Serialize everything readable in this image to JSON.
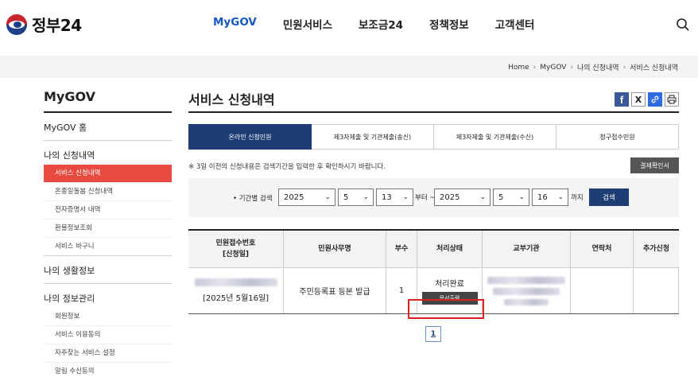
{
  "header": {
    "logo_text": "정부24",
    "nav": [
      {
        "label": "MyGOV",
        "active": true
      },
      {
        "label": "민원서비스",
        "active": false
      },
      {
        "label": "보조금24",
        "active": false
      },
      {
        "label": "정책정보",
        "active": false
      },
      {
        "label": "고객센터",
        "active": false
      }
    ],
    "search_icon": "search-icon"
  },
  "breadcrumb": [
    "Home",
    "MyGOV",
    "나의 신청내역",
    "서비스 신청내역"
  ],
  "sidebar": {
    "title": "MyGOV",
    "sections": [
      {
        "label": "MyGOV 홈",
        "items": []
      },
      {
        "label": "나의 신청내역",
        "items": [
          {
            "label": "서비스 신청내역",
            "active": true
          },
          {
            "label": "온종일돌봄 신청내역",
            "active": false
          },
          {
            "label": "전자증명서 내역",
            "active": false
          },
          {
            "label": "환불정보조회",
            "active": false
          },
          {
            "label": "서비스 바구니",
            "active": false
          }
        ]
      },
      {
        "label": "나의 생활정보",
        "items": []
      },
      {
        "label": "나의 정보관리",
        "items": [
          {
            "label": "회원정보",
            "active": false
          },
          {
            "label": "서비스 이용동의",
            "active": false
          },
          {
            "label": "자주찾는 서비스 설정",
            "active": false
          },
          {
            "label": "알림 수신동의",
            "active": false
          }
        ]
      }
    ]
  },
  "content": {
    "title": "서비스 신청내역",
    "share_icons": [
      "facebook-icon",
      "x-icon",
      "link-icon",
      "print-icon"
    ],
    "tabs": [
      {
        "label": "온라인 신청민원",
        "active": true
      },
      {
        "label": "제3자제출 및 기관제출(송신)",
        "active": false
      },
      {
        "label": "제3자제출 및 기관제출(수신)",
        "active": false
      },
      {
        "label": "청구접수민원",
        "active": false
      }
    ],
    "notice": "※ 3일 이전의 신청내용은 검색기간을 입력한 후 확인하시기 바랍니다.",
    "receipt_button": "결제확인서",
    "filter": {
      "label": "• 기간별 검색",
      "from_year": "2025",
      "from_month": "5",
      "from_day": "13",
      "from_text": "부터 ~",
      "to_year": "2025",
      "to_month": "5",
      "to_day": "16",
      "to_text": "까지",
      "search_button": "검색"
    },
    "table": {
      "headers": [
        "민원접수번호",
        "[신청일]",
        "민원사무명",
        "부수",
        "처리상태",
        "교부기관",
        "연락처",
        "추가신청"
      ],
      "rows": [
        {
          "date": "[2025년 5월16일]",
          "service": "주민등록표 등본 발급",
          "copies": "1",
          "status": "처리완료",
          "print_button": "문서출력"
        }
      ]
    },
    "pagination": [
      "1"
    ]
  },
  "colors": {
    "accent_blue": "#1558c2",
    "navy": "#1f3d75",
    "active_red": "#e94a3f",
    "highlight_red": "#d92121"
  }
}
